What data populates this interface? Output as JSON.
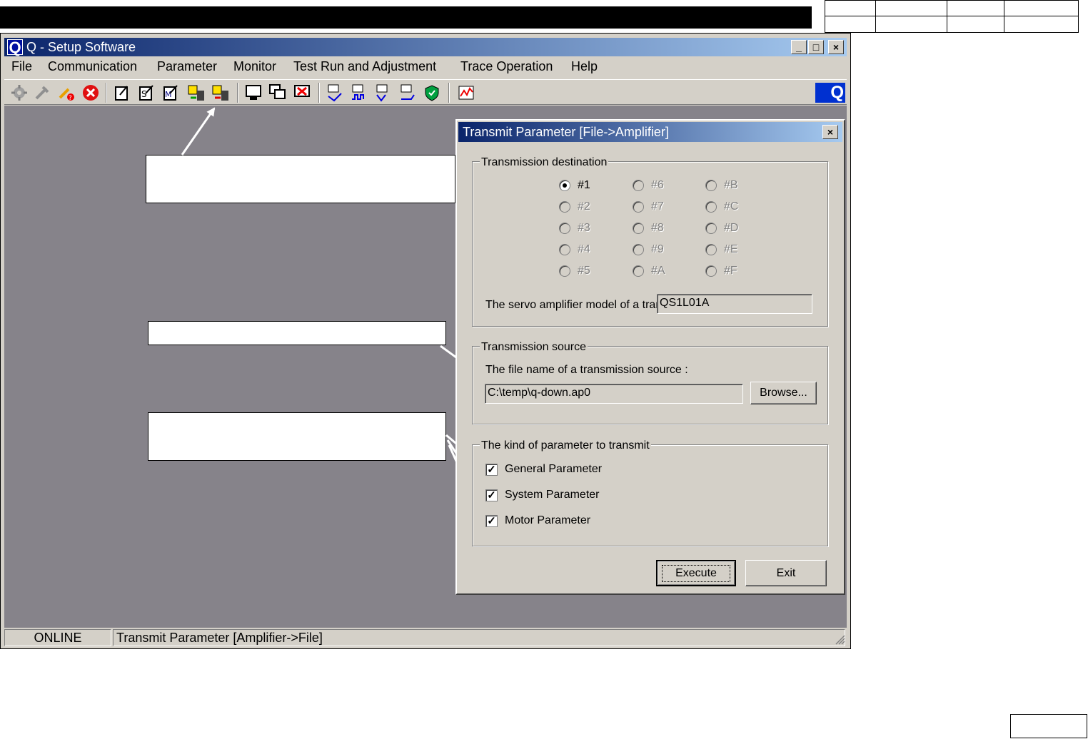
{
  "window": {
    "logo_letter": "Q",
    "title": "Q - Setup Software",
    "minimize": "_",
    "maximize": "□",
    "close": "×"
  },
  "menu": [
    "File",
    "Communication",
    "Parameter",
    "Monitor",
    "Test Run and Adjustment",
    "Trace Operation",
    "Help"
  ],
  "toolbar_icons": [
    "gear-gray-icon",
    "plug-gray-icon",
    "plug-disconnect-icon",
    "stop-red-icon",
    "edit-note-icon",
    "edit-check-icon",
    "edit-motor-icon",
    "transmit-file-amp-icon",
    "transmit-amp-file-icon",
    "monitor-icon",
    "monitor-multi-icon",
    "monitor-stop-icon",
    "test-run-jog-icon",
    "test-run-pulse-icon",
    "test-run-zero-icon",
    "test-run-pos-icon",
    "shield-icon",
    "trace-graph-icon"
  ],
  "toolbar_corner_logo": "Q",
  "status": {
    "mode": "ONLINE",
    "message": "Transmit Parameter [Amplifier->File]"
  },
  "dialog": {
    "title": "Transmit Parameter [File->Amplifier]",
    "close": "×",
    "dest_group": "Transmission destination",
    "stations": [
      [
        {
          "label": "#1",
          "checked": true,
          "enabled": true
        },
        {
          "label": "#6",
          "checked": false,
          "enabled": false
        },
        {
          "label": "#B",
          "checked": false,
          "enabled": false
        }
      ],
      [
        {
          "label": "#2",
          "checked": false,
          "enabled": false
        },
        {
          "label": "#7",
          "checked": false,
          "enabled": false
        },
        {
          "label": "#C",
          "checked": false,
          "enabled": false
        }
      ],
      [
        {
          "label": "#3",
          "checked": false,
          "enabled": false
        },
        {
          "label": "#8",
          "checked": false,
          "enabled": false
        },
        {
          "label": "#D",
          "checked": false,
          "enabled": false
        }
      ],
      [
        {
          "label": "#4",
          "checked": false,
          "enabled": false
        },
        {
          "label": "#9",
          "checked": false,
          "enabled": false
        },
        {
          "label": "#E",
          "checked": false,
          "enabled": false
        }
      ],
      [
        {
          "label": "#5",
          "checked": false,
          "enabled": false
        },
        {
          "label": "#A",
          "checked": false,
          "enabled": false
        },
        {
          "label": "#F",
          "checked": false,
          "enabled": false
        }
      ]
    ],
    "model_label": "The servo amplifier model of a trar",
    "model_value": "QS1L01A",
    "source_group": "Transmission source",
    "source_label": "The file name of a transmission source :",
    "source_value": "C:\\temp\\q-down.ap0",
    "browse_label": "Browse...",
    "kind_group": "The kind of parameter to transmit",
    "kinds": [
      {
        "label": "General Parameter",
        "checked": true
      },
      {
        "label": "System Parameter",
        "checked": true
      },
      {
        "label": "Motor Parameter",
        "checked": true
      }
    ],
    "check_mark": "✓",
    "execute_label": "Execute",
    "exit_label": "Exit"
  }
}
